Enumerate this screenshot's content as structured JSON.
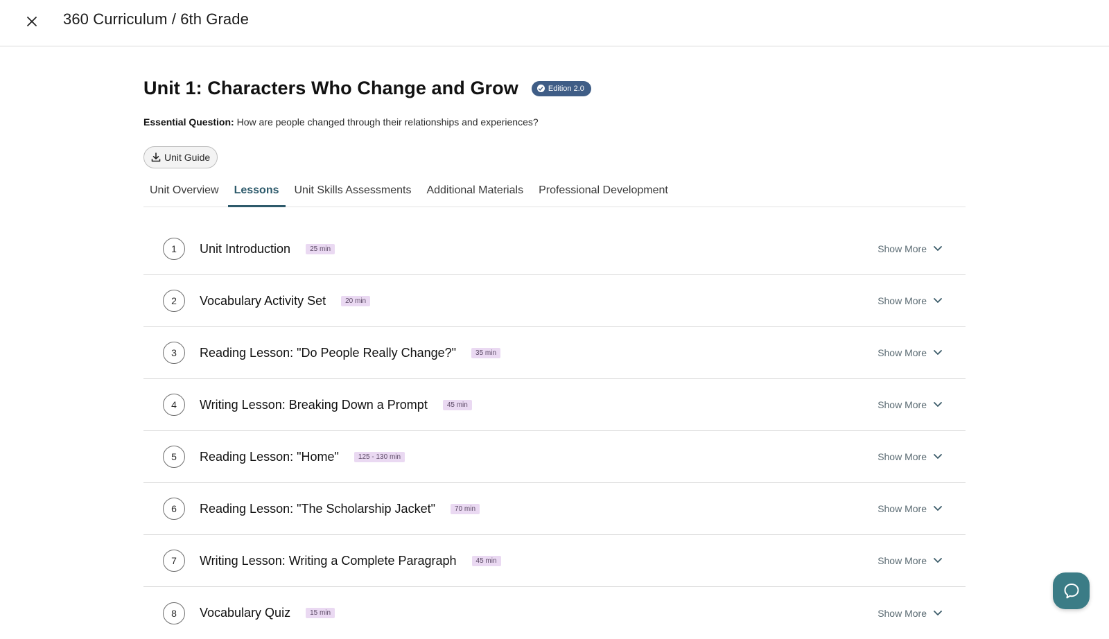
{
  "header": {
    "title": "360 Curriculum / 6th Grade"
  },
  "unit": {
    "title": "Unit 1: Characters Who Change and Grow",
    "edition": "Edition 2.0",
    "essential_label": "Essential Question:",
    "essential_text": "How are people changed through their relationships and experiences?",
    "guide_label": "Unit Guide"
  },
  "tabs": [
    {
      "label": "Unit Overview"
    },
    {
      "label": "Lessons"
    },
    {
      "label": "Unit Skills Assessments"
    },
    {
      "label": "Additional Materials"
    },
    {
      "label": "Professional Development"
    }
  ],
  "active_tab": "Lessons",
  "show_more_label": "Show More",
  "lessons": [
    {
      "num": "1",
      "title": "Unit Introduction",
      "duration": "25 min"
    },
    {
      "num": "2",
      "title": "Vocabulary Activity Set",
      "duration": "20 min"
    },
    {
      "num": "3",
      "title": "Reading Lesson: \"Do People Really Change?\"",
      "duration": "35 min"
    },
    {
      "num": "4",
      "title": "Writing Lesson: Breaking Down a Prompt",
      "duration": "45 min"
    },
    {
      "num": "5",
      "title": "Reading Lesson: \"Home\"",
      "duration": "125 - 130 min"
    },
    {
      "num": "6",
      "title": "Reading Lesson: \"The Scholarship Jacket\"",
      "duration": "70 min"
    },
    {
      "num": "7",
      "title": "Writing Lesson: Writing a Complete Paragraph",
      "duration": "45 min"
    },
    {
      "num": "8",
      "title": "Vocabulary Quiz",
      "duration": "15 min"
    }
  ],
  "colors": {
    "accent": "#2d5a6b",
    "badge": "#3f5d86",
    "duration_bg": "#ead9f2",
    "chat": "#3b7c86"
  }
}
